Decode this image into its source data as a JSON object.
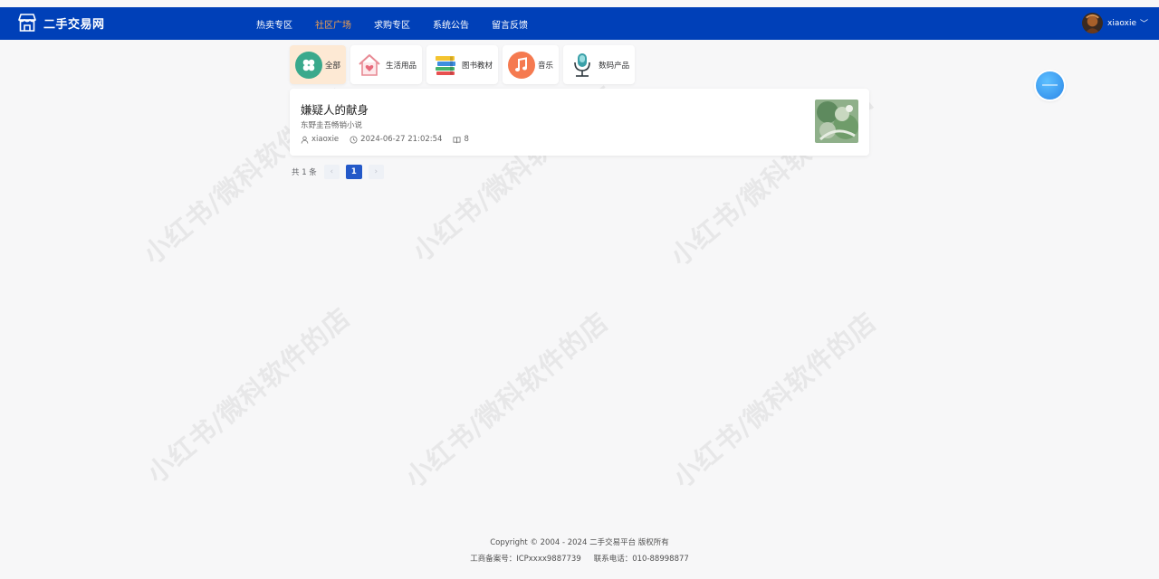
{
  "header": {
    "logo_text": "二手交易网",
    "nav": [
      {
        "label": "热卖专区"
      },
      {
        "label": "社区广场"
      },
      {
        "label": "求购专区"
      },
      {
        "label": "系统公告"
      },
      {
        "label": "留言反馈"
      }
    ],
    "active_nav": "社区广场",
    "user_name": "xiaoxie",
    "user_chevron": "﹀",
    "accent_color": "#0040b8",
    "active_nav_color": "#f0a050"
  },
  "categories": [
    {
      "label": "全部",
      "icon": "clover-icon",
      "active": true
    },
    {
      "label": "生活用品",
      "icon": "home-heart-icon",
      "active": false
    },
    {
      "label": "图书教材",
      "icon": "books-icon",
      "active": false
    },
    {
      "label": "音乐",
      "icon": "music-note-icon",
      "active": false
    },
    {
      "label": "数码产品",
      "icon": "microphone-icon",
      "active": false
    }
  ],
  "post": {
    "title": "嫌疑人的献身",
    "description": "东野圭吾畅销小说",
    "author": "xiaoxie",
    "time": "2024-06-27 21:02:54",
    "views": "8"
  },
  "pagination": {
    "total": "共 1 条",
    "prev": "‹",
    "current": "1",
    "next": "›"
  },
  "watermark": "小红书/微科软件的店",
  "footer": {
    "copyright": "Copyright © 2004 - 2024 二手交易平台 版权所有",
    "icp": "工商备案号：ICPxxxx9887739",
    "phone": "联系电话：010-88998877"
  }
}
